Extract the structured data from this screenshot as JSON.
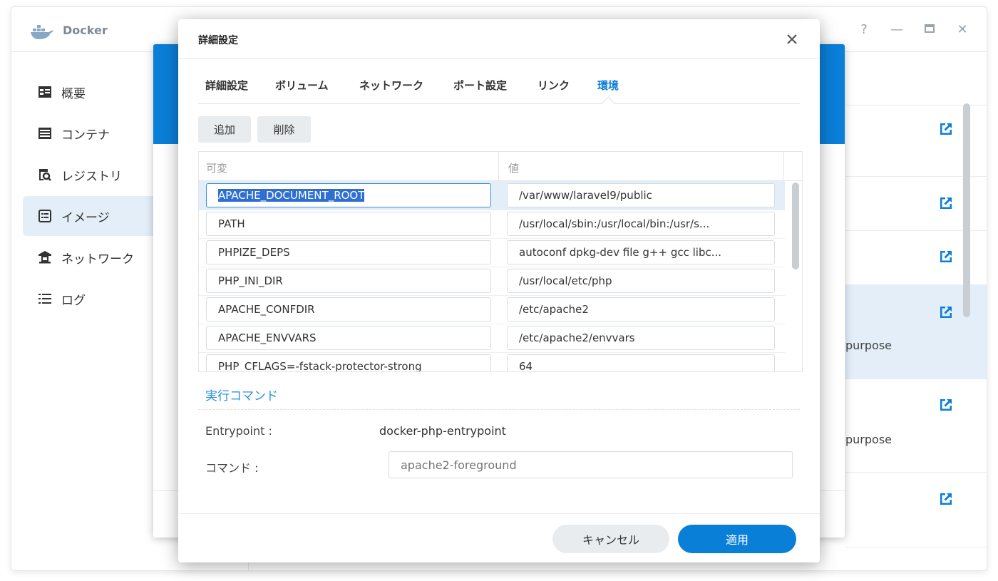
{
  "app": {
    "title": "Docker",
    "controls": [
      "help-icon",
      "minimize-icon",
      "maximize-icon",
      "close-icon"
    ]
  },
  "sidebar": {
    "items": [
      {
        "label": "概要",
        "icon": "overview-icon",
        "active": false
      },
      {
        "label": "コンテナ",
        "icon": "container-icon",
        "active": false
      },
      {
        "label": "レジストリ",
        "icon": "registry-search-icon",
        "active": false
      },
      {
        "label": "イメージ",
        "icon": "image-icon",
        "active": true
      },
      {
        "label": "ネットワーク",
        "icon": "network-icon",
        "active": false
      },
      {
        "label": "ログ",
        "icon": "log-list-icon",
        "active": false
      }
    ]
  },
  "background_rows": {
    "purpose_1": "purpose",
    "purpose_2": "purpose"
  },
  "dialog": {
    "title": "詳細設定",
    "tabs": [
      {
        "label": "詳細設定",
        "active": false
      },
      {
        "label": "ボリューム",
        "active": false
      },
      {
        "label": "ネットワーク",
        "active": false
      },
      {
        "label": "ポート設定",
        "active": false
      },
      {
        "label": "リンク",
        "active": false
      },
      {
        "label": "環境",
        "active": true
      }
    ],
    "toolbar": {
      "add_label": "追加",
      "delete_label": "削除"
    },
    "env_table": {
      "columns": [
        "可変",
        "値"
      ],
      "rows": [
        {
          "variable": "APACHE_DOCUMENT_ROOT",
          "value": "/var/www/laravel9/public"
        },
        {
          "variable": "PATH",
          "value": "/usr/local/sbin:/usr/local/bin:/usr/s..."
        },
        {
          "variable": "PHPIZE_DEPS",
          "value": "autoconf dpkg-dev file g++ gcc libc..."
        },
        {
          "variable": "PHP_INI_DIR",
          "value": "/usr/local/etc/php"
        },
        {
          "variable": "APACHE_CONFDIR",
          "value": "/etc/apache2"
        },
        {
          "variable": "APACHE_ENVVARS",
          "value": "/etc/apache2/envvars"
        },
        {
          "variable": "PHP_CFLAGS=-fstack-protector-strong",
          "value": "64"
        }
      ]
    },
    "exec": {
      "section_title": "実行コマンド",
      "entrypoint_label": "Entrypoint :",
      "entrypoint_value": "docker-php-entrypoint",
      "command_label": "コマンド :",
      "command_placeholder": "apache2-foreground"
    },
    "footer": {
      "cancel_label": "キャンセル",
      "apply_label": "適用"
    }
  },
  "colors": {
    "accent": "#0a7fd8",
    "selection": "#2f6fd1",
    "row_highlight": "#e3eef9",
    "sidebar_active": "#e4eef8"
  }
}
